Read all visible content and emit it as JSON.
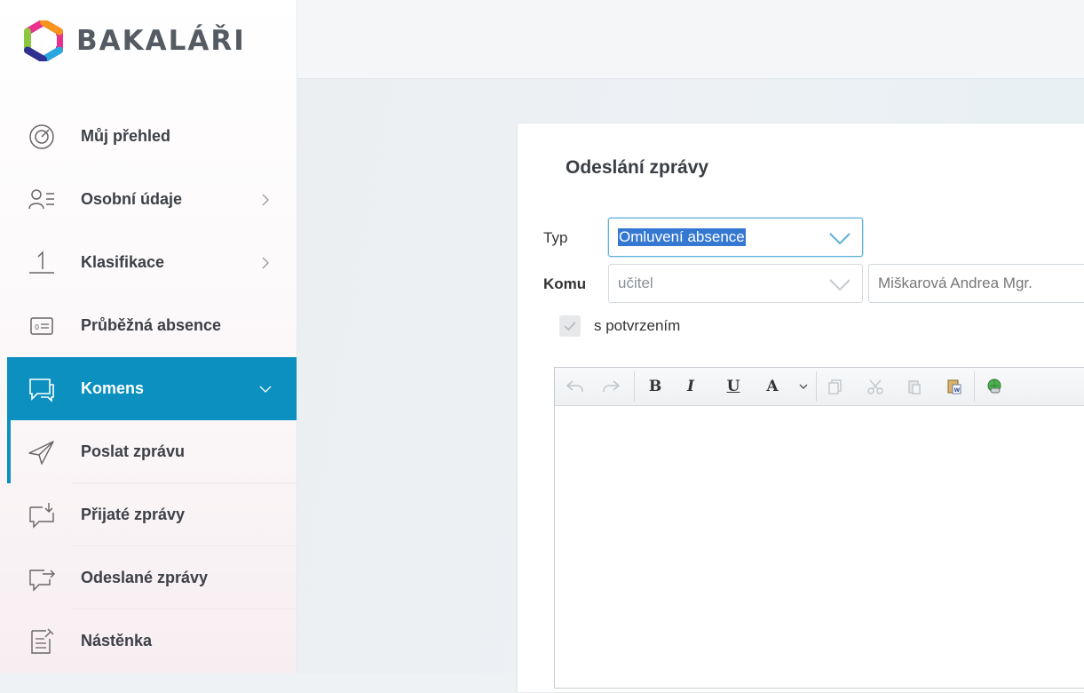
{
  "brand": {
    "name": "BAKALÁŘI",
    "colors": {
      "accent": "#0b90bf",
      "highlight": "#3478d1"
    }
  },
  "sidebar": {
    "items": [
      {
        "label": "Můj přehled",
        "icon": "target-icon",
        "has_chevron": false
      },
      {
        "label": "Osobní údaje",
        "icon": "user-card-icon",
        "has_chevron": true
      },
      {
        "label": "Klasifikace",
        "icon": "grade-one-icon",
        "has_chevron": true
      },
      {
        "label": "Průběžná absence",
        "icon": "absence-icon",
        "has_chevron": false
      },
      {
        "label": "Komens",
        "icon": "chat-icon",
        "has_chevron": true,
        "expanded": true
      },
      {
        "label": "Poslat zprávu",
        "icon": "paper-plane-icon",
        "sub": true,
        "current": true
      },
      {
        "label": "Přijaté zprávy",
        "icon": "inbox-message-icon",
        "sub": true
      },
      {
        "label": "Odeslané zprávy",
        "icon": "sent-message-icon",
        "sub": true
      },
      {
        "label": "Nástěnka",
        "icon": "noticeboard-icon",
        "sub": true
      }
    ]
  },
  "form": {
    "title": "Odeslání zprávy",
    "type_label": "Typ",
    "type_value": "Omluvení absence",
    "to_label": "Komu",
    "recipient_group": "učitel",
    "recipient_name": "Miškarová Andrea Mgr.",
    "confirm_label": "s potvrzením",
    "confirm_checked": true
  },
  "editor": {
    "toolbar": {
      "undo": "undo-icon",
      "redo": "redo-icon",
      "bold": "B",
      "italic": "I",
      "underline": "U",
      "font_color": "A",
      "copy": "copy-icon",
      "cut": "cut-icon",
      "paste": "paste-icon",
      "paste_word": "paste-word-icon",
      "link": "link-icon"
    }
  }
}
